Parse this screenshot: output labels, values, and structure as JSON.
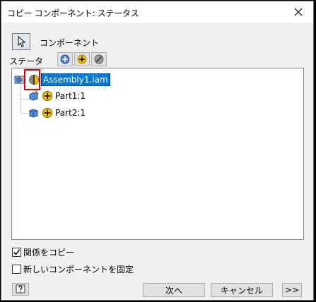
{
  "window": {
    "title": "コピー コンポーネント: ステータス"
  },
  "mode": {
    "label": "コンポーネント",
    "icon": "cursor-select-icon"
  },
  "status": {
    "label": "ステータ"
  },
  "toolbar": {
    "icons": [
      "include-all-icon",
      "include-icon",
      "exclude-icon"
    ]
  },
  "tree": {
    "root": {
      "label": "Assembly1.iam",
      "icon": "assembly-icon",
      "status_icon": "half-status-icon"
    },
    "children": [
      {
        "label": "Part1:1",
        "icon": "part-icon",
        "status_icon": "include-status-icon"
      },
      {
        "label": "Part2:1",
        "icon": "part-icon",
        "status_icon": "include-status-icon"
      }
    ]
  },
  "options": {
    "copy_relations": {
      "label": "関係をコピー",
      "checked": true
    },
    "fix_new": {
      "label": "新しいコンポーネントを固定",
      "checked": false
    }
  },
  "buttons": {
    "next": "次へ",
    "cancel": "キャンセル",
    "expand": ">>"
  },
  "colors": {
    "selection": "#0078d7",
    "highlight": "#e00000",
    "include": "#f5c400"
  }
}
